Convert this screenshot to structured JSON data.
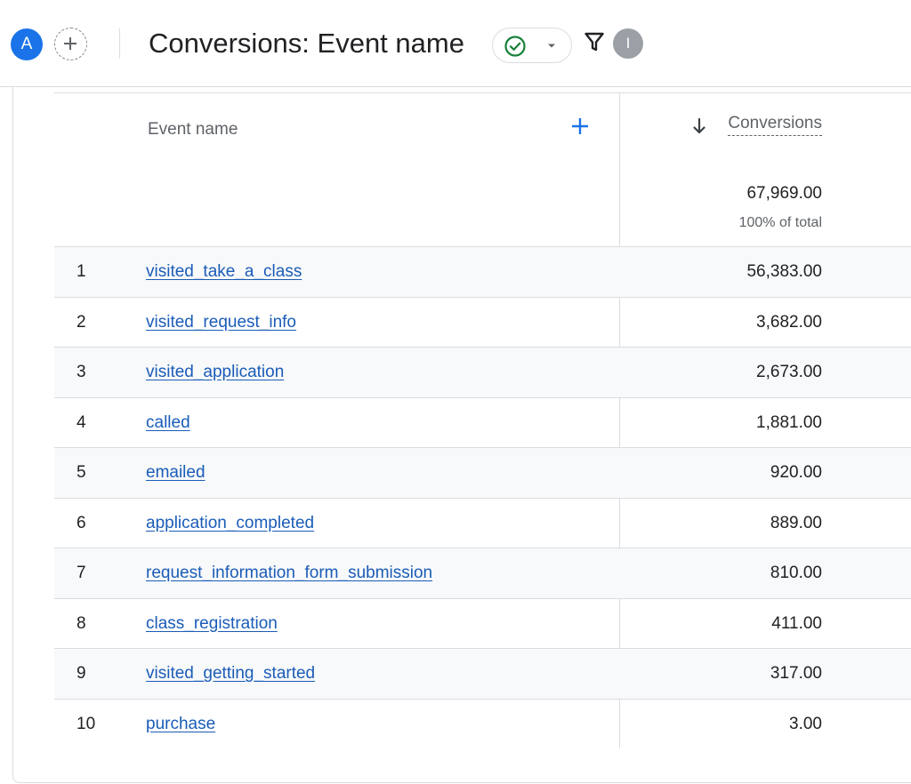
{
  "header": {
    "avatar_letter": "A",
    "title": "Conversions: Event name",
    "info_letter": "I",
    "icons": [
      "add-comparison-icon",
      "check-circle-icon",
      "caret-down-icon",
      "filter-icon"
    ],
    "colors": {
      "avatar": "#1a73e8",
      "check": "#188038",
      "link": "#1a5cb8"
    }
  },
  "table": {
    "dimension_header": "Event name",
    "metric_header": "Conversions",
    "sort": "descending",
    "total_value": "67,969.00",
    "total_pct": "100% of total",
    "rows": [
      {
        "index": "1",
        "name": "visited_take_a_class",
        "value": "56,383.00"
      },
      {
        "index": "2",
        "name": "visited_request_info",
        "value": "3,682.00"
      },
      {
        "index": "3",
        "name": "visited_application",
        "value": "2,673.00"
      },
      {
        "index": "4",
        "name": "called",
        "value": "1,881.00"
      },
      {
        "index": "5",
        "name": "emailed",
        "value": "920.00"
      },
      {
        "index": "6",
        "name": "application_completed",
        "value": "889.00"
      },
      {
        "index": "7",
        "name": "request_information_form_submission",
        "value": "810.00"
      },
      {
        "index": "8",
        "name": "class_registration",
        "value": "411.00"
      },
      {
        "index": "9",
        "name": "visited_getting_started",
        "value": "317.00"
      },
      {
        "index": "10",
        "name": "purchase",
        "value": "3.00"
      }
    ]
  }
}
